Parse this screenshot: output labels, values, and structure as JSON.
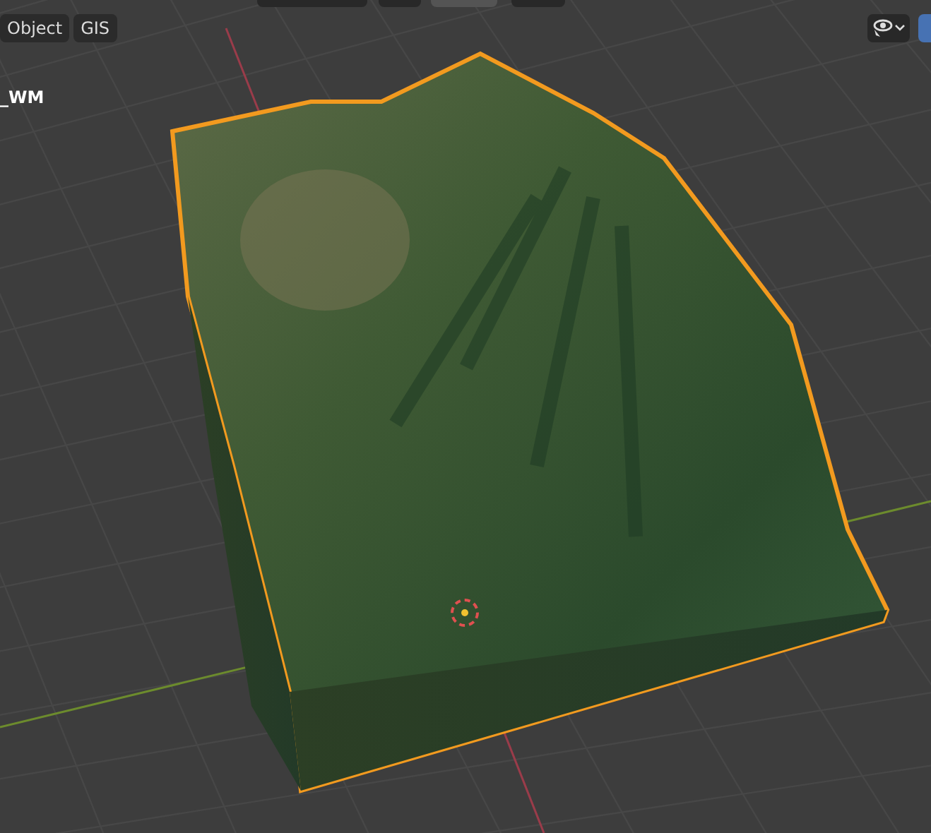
{
  "header_menu": [
    {
      "label": "Object"
    },
    {
      "label": "GIS"
    }
  ],
  "object_name": "_WM"
}
